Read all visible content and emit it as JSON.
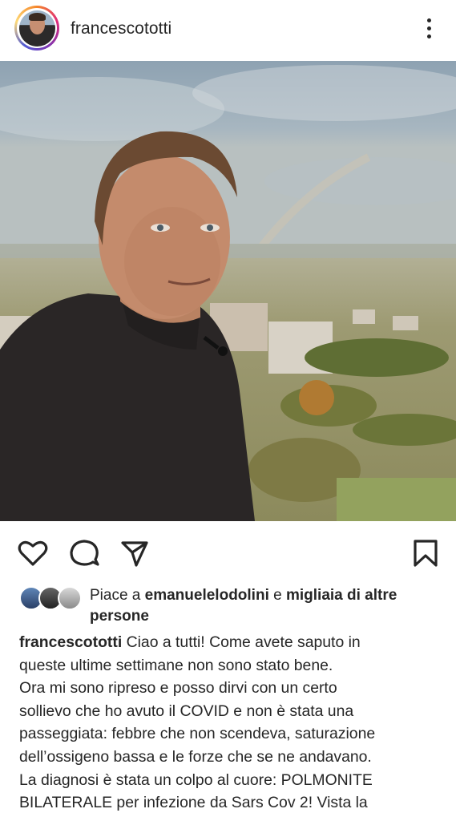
{
  "header": {
    "username": "francescototti",
    "avatar_icon": "profile-avatar",
    "more_icon": "more-vertical-icon"
  },
  "photo": {
    "subject": "post-photo"
  },
  "actions": {
    "like_icon": "heart-icon",
    "comment_icon": "comment-icon",
    "share_icon": "send-icon",
    "save_icon": "bookmark-icon"
  },
  "likes": {
    "prefix": "Piace a ",
    "user": "emanuelelodolini",
    "middle": " e ",
    "others": "migliaia di altre persone"
  },
  "caption": {
    "username": "francescototti",
    "lines": [
      " Ciao a tutti! Come avete saputo in",
      "queste ultime settimane non sono stato bene.",
      "Ora mi sono ripreso e posso dirvi con un certo",
      "sollievo che ho avuto il COVID e non è stata una",
      "passeggiata: febbre che non scendeva, saturazione",
      "dell’ossigeno bassa e le forze che se ne andavano.",
      "La diagnosi è stata un colpo al cuore: POLMONITE",
      "BILATERALE per infezione da Sars Cov 2! Vista la"
    ]
  },
  "colors": {
    "text": "#262626",
    "background": "#ffffff"
  }
}
